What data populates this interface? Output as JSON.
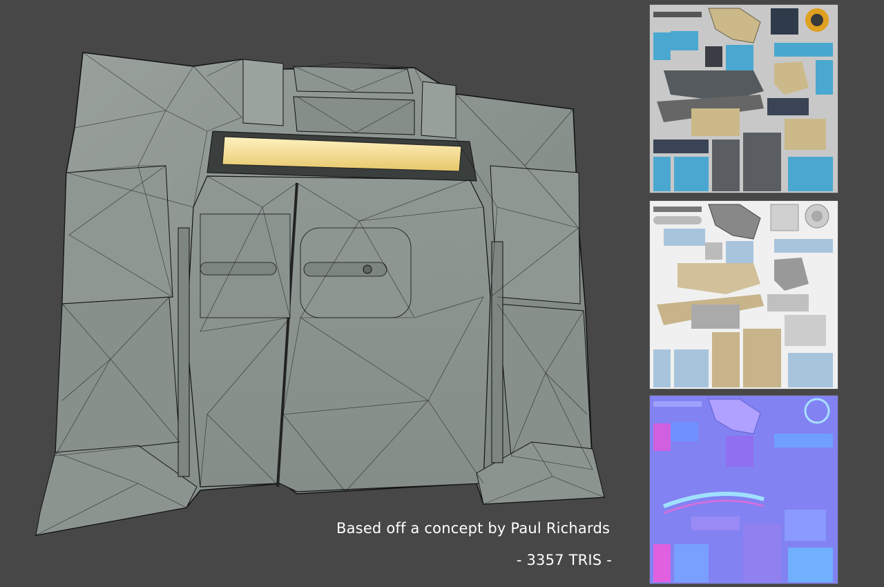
{
  "captions": {
    "credit": "Based off a concept by Paul Richards",
    "tris": "- 3357 TRIS -"
  },
  "texture_maps": {
    "diffuse": "diffuse-map",
    "specular": "specular-map",
    "normal": "normal-map"
  },
  "colors": {
    "background": "#474747",
    "model_base": "#8e9690",
    "wire": "#111111",
    "light_strip": "#f0d890",
    "diffuse_blue": "#4aa8d0",
    "diffuse_tan": "#cbb98a",
    "normal_base": "#8080f0"
  }
}
